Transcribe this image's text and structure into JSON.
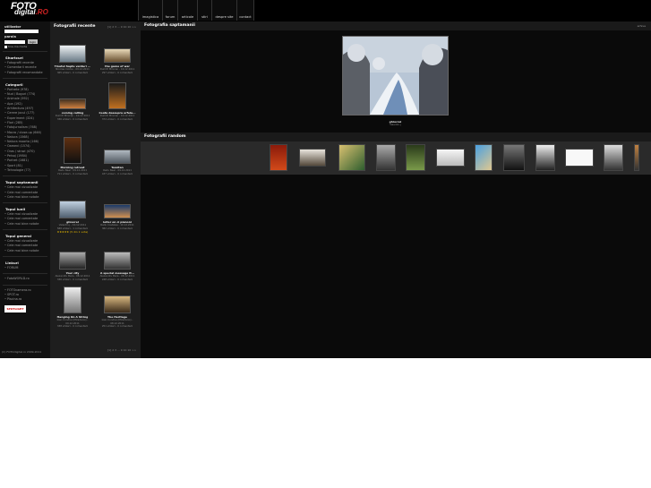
{
  "header": {
    "logo_line1": "FOTO",
    "logo_line2": "digital",
    "logo_suffix": ".RO",
    "nav": [
      "imagistica",
      "forum",
      "articole",
      "stiri",
      "despre site",
      "contact"
    ]
  },
  "sidebar": {
    "login": {
      "user_label": "utilizator",
      "pass_label": "parola",
      "button_label": "login",
      "remember_label": "tine-ma minte"
    },
    "sections": [
      {
        "title": "Shortcuri",
        "items": [
          "Fotografii recente",
          "Comentarii recente",
          "Fotografii recomandate"
        ]
      },
      {
        "title": "Categorii",
        "items": [
          "Portrete (978)",
          "Nud / Boguri (774)",
          "Animale (592)",
          "Apa (192)",
          "Arhitectura (497)",
          "Cerere jocul (177)",
          "Experiment (324)",
          "Flori (285)",
          "Fotojurnalism (768)",
          "Macro / close-up (646)",
          "Natura (1568)",
          "Natura moarta (166)",
          "Oameni (1574)",
          "Oras / strazi (470)",
          "Peisaj (1984)",
          "Portret (1681)",
          "Sport (81)",
          "Tehnologie (77)"
        ]
      },
      {
        "title": "Topul saptamanii",
        "items": [
          "Cele mai vizualizate",
          "Cele mai comentate",
          "Cele mai bine notate"
        ]
      },
      {
        "title": "Topul lunii",
        "items": [
          "Cele mai vizualizate",
          "Cele mai comentate",
          "Cele mai bine notate"
        ]
      },
      {
        "title": "Topul general",
        "items": [
          "Cele mai vizualizate",
          "Cele mai comentate",
          "Cele mai bine notate"
        ]
      },
      {
        "title": "Linkuri",
        "items": [
          "FORUM"
        ]
      }
    ],
    "extra_links": [
      "FotoWORLD.ro",
      "FOTOcamera.ro",
      "SPOT.ro",
      "Piscina.ro"
    ],
    "badge": "SPOTLIGHT",
    "copyright": "(C) FOTOdigital.ro 2009-2011"
  },
  "recent": {
    "title": "Fotografii recente",
    "pager": "[1] 2 3 ... 9 10 10 >>",
    "items": [
      {
        "title": "Tinutul Sapte venturi ...",
        "meta1": "Nicolae Ciorbe - 09.12.2011",
        "meta2": "365 vilizari - 0 comentarii"
      },
      {
        "title": "the game of war",
        "meta1": "Dumitr Minican - 16.12.2011",
        "meta2": "297 vilizari - 0 comentarii"
      },
      {
        "title": "coming calling",
        "meta1": "Dumitr Minican - 10.12.2011",
        "meta2": "336 vilizari - 0 comentarii"
      },
      {
        "title": "Ceata deasupra orfelu...",
        "meta1": "Dumitr Minican - 10.12.2011",
        "meta2": "374 vilizari - 0 comentarii"
      },
      {
        "title": "Morning retreat",
        "meta1": "Radu Nael - 09.12.2011",
        "meta2": "711 vilizari - 0 comentarii"
      },
      {
        "title": "Tomitan",
        "meta1": "Radu Nael - 09.12.2011",
        "meta2": "437 vilizari - 0 comentarii"
      },
      {
        "title": "ghiocrel",
        "meta1": "Valentin.j - 10.12.2011",
        "meta2": "588 vilizari - 1 comentarii",
        "stars": "★★★★★ (5 din 1 vote)"
      },
      {
        "title": "loiter on ci pianoni",
        "meta1": "Radu Costalea - 10.12.2011",
        "meta2": "382 vilizari - 0 comentarii"
      },
      {
        "title": "Your city",
        "meta1": "Alexandru Bara - 08.12.2011",
        "meta2": "336 vilizari - 0 comentarii"
      },
      {
        "title": "A special message fr...",
        "meta1": "Alexandru Bara - 08.12.2011",
        "meta2": "248 vilizari - 0 comentarii"
      },
      {
        "title": "Hanging On A String",
        "meta1": "Ioan Condrei (Miradonis) - 09.12.2011",
        "meta2": "338 vilizari - 0 comentarii"
      },
      {
        "title": "The Heritage",
        "meta1": "Ioan Condrei (Miradonis) - 08.12.2011",
        "meta2": "251 vilizari - 0 comentarii"
      }
    ]
  },
  "weekly": {
    "title": "Fotografia saptamanii",
    "link": "arhiva",
    "photo_title": "ghiocrel",
    "photo_author": "Valentin.j"
  },
  "random": {
    "title": "Fotografii random"
  },
  "colors": {
    "background": "#000000",
    "panel": "#1e1e1e",
    "accent": "#cc2222"
  }
}
